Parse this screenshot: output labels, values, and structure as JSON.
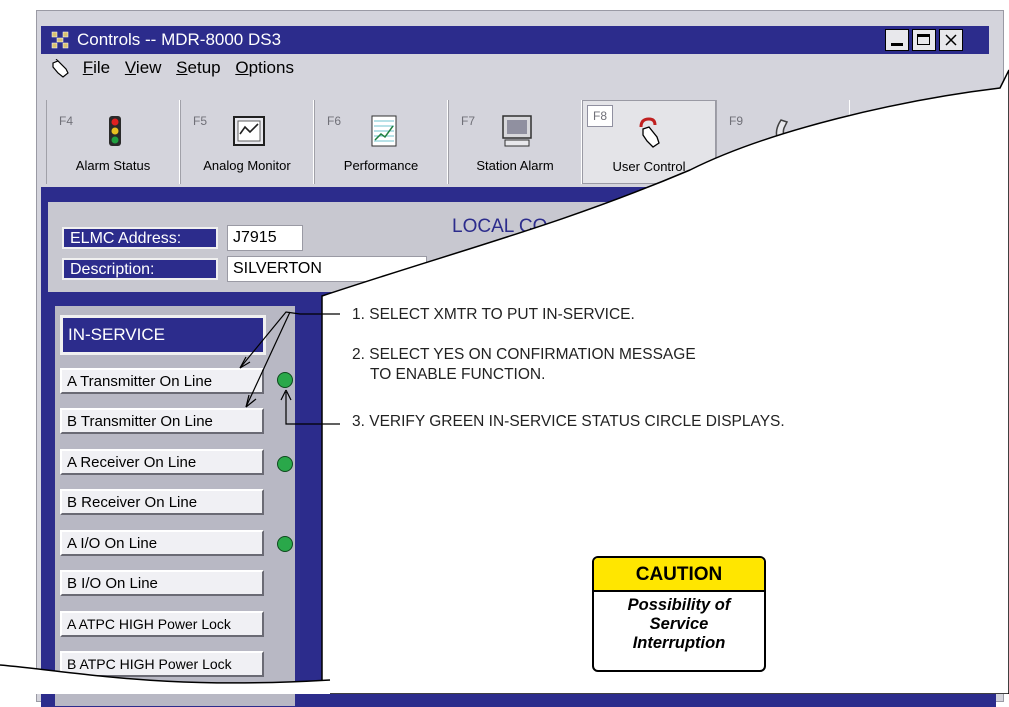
{
  "window": {
    "title": "Controls -- MDR-8000 DS3"
  },
  "menu": [
    "File",
    "View",
    "Setup",
    "Options"
  ],
  "tabs": [
    {
      "key": "F4",
      "label": "Alarm Status",
      "icon": "traffic-light-icon"
    },
    {
      "key": "F5",
      "label": "Analog Monitor",
      "icon": "monitor-waveform-icon"
    },
    {
      "key": "F6",
      "label": "Performance",
      "icon": "chart-document-icon"
    },
    {
      "key": "F7",
      "label": "Station Alarm",
      "icon": "computer-icon"
    },
    {
      "key": "F8",
      "label": "User Control",
      "icon": "hand-pointer-icon"
    },
    {
      "key": "F9",
      "label": "",
      "icon": "phone-icon"
    }
  ],
  "form": {
    "elmc_label": "ELMC Address:",
    "elmc_value": "J7915",
    "desc_label": "Description:",
    "desc_value": "SILVERTON",
    "local_heading": "LOCAL CO"
  },
  "in_service": {
    "header": "IN-SERVICE",
    "items": [
      {
        "label": "A Transmitter On Line",
        "status": "green"
      },
      {
        "label": "B Transmitter On Line",
        "status": ""
      },
      {
        "label": "A Receiver On Line",
        "status": "green"
      },
      {
        "label": "B Receiver On Line",
        "status": ""
      },
      {
        "label": "A I/O On Line",
        "status": "green"
      },
      {
        "label": "B I/O On Line",
        "status": ""
      },
      {
        "label": "A ATPC HIGH Power Lock",
        "status": ""
      },
      {
        "label": "B ATPC HIGH Power Lock",
        "status": ""
      }
    ]
  },
  "instructions": [
    "1.  SELECT XMTR TO PUT IN-SERVICE.",
    "2.  SELECT YES ON CONFIRMATION MESSAGE",
    "TO ENABLE FUNCTION.",
    "3.  VERIFY GREEN IN-SERVICE STATUS CIRCLE DISPLAYS."
  ],
  "caution": {
    "title": "CAUTION",
    "line1": "Possibility of",
    "line2": "Service",
    "line3": "Interruption"
  },
  "colors": {
    "navy": "#2c2c8c",
    "status_green": "#2aa84a",
    "caution_yellow": "#ffe600"
  }
}
